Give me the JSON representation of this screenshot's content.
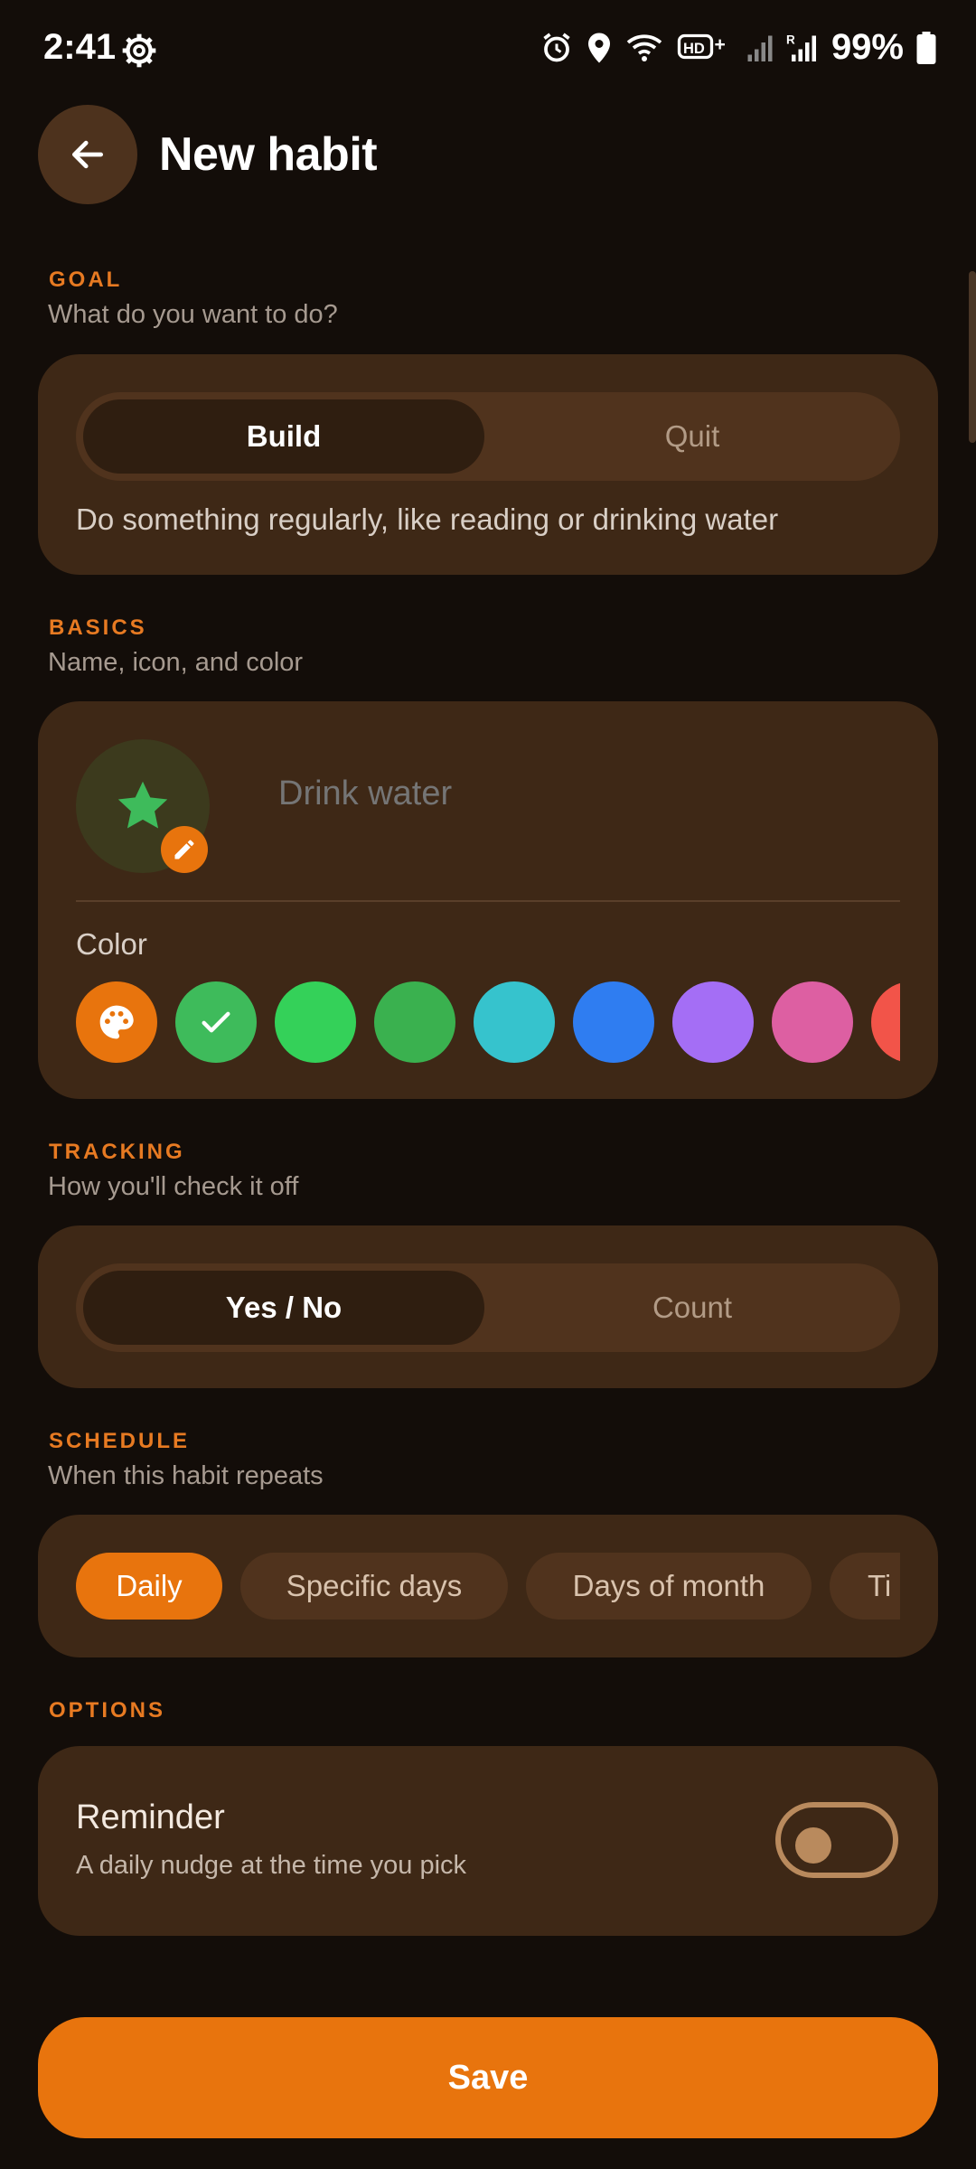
{
  "status": {
    "time": "2:41",
    "battery": "99%",
    "icons": [
      "gear-icon",
      "alarm-icon",
      "location-icon",
      "wifi-icon",
      "hd-plus-icon",
      "signal-icon",
      "signal-roaming-icon",
      "battery-icon"
    ]
  },
  "header": {
    "title": "New habit",
    "back_icon": "arrow-left-icon"
  },
  "goal": {
    "label": "GOAL",
    "sub": "What do you want to do?",
    "options": [
      "Build",
      "Quit"
    ],
    "selected": "Build",
    "description": "Do something regularly, like reading or drinking water"
  },
  "basics": {
    "label": "BASICS",
    "sub": "Name, icon, and color",
    "name_placeholder": "Drink water",
    "icon": "star-icon",
    "color_label": "Color",
    "swatches": [
      {
        "name": "custom-palette",
        "color": "#e8740d"
      },
      {
        "name": "green-selected",
        "color": "#3ebb5b"
      },
      {
        "name": "green",
        "color": "#34d159"
      },
      {
        "name": "dark-green",
        "color": "#3ab14f"
      },
      {
        "name": "teal",
        "color": "#36c3cd"
      },
      {
        "name": "blue",
        "color": "#2f7df1"
      },
      {
        "name": "purple",
        "color": "#a46ef5"
      },
      {
        "name": "pink",
        "color": "#dd5fa2"
      },
      {
        "name": "red",
        "color": "#f25449"
      }
    ]
  },
  "tracking": {
    "label": "TRACKING",
    "sub": "How you'll check it off",
    "options": [
      "Yes / No",
      "Count"
    ],
    "selected": "Yes / No"
  },
  "schedule": {
    "label": "SCHEDULE",
    "sub": "When this habit repeats",
    "chips": [
      "Daily",
      "Specific days",
      "Days of month",
      "Ti"
    ],
    "selected": "Daily"
  },
  "options": {
    "label": "OPTIONS",
    "reminder_title": "Reminder",
    "reminder_sub": "A daily nudge at the time you pick",
    "reminder_on": false
  },
  "save_label": "Save",
  "colors": {
    "accent": "#e8740d",
    "background": "#130d09",
    "card": "#3e2816"
  }
}
